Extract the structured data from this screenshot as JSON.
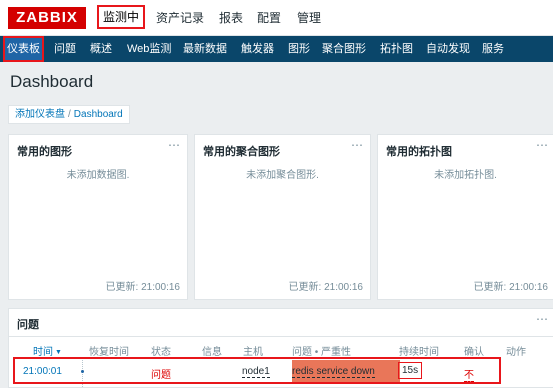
{
  "header": {
    "logo": "ZABBIX",
    "menu": [
      "监测中",
      "资产记录",
      "报表",
      "配置",
      "管理"
    ]
  },
  "subnav": [
    "仪表板",
    "问题",
    "概述",
    "Web监测",
    "最新数据",
    "触发器",
    "图形",
    "聚合图形",
    "拓扑图",
    "自动发现",
    "服务"
  ],
  "page": {
    "title": "Dashboard",
    "breadcrumb": [
      "添加仪表盘",
      "Dashboard"
    ]
  },
  "widgets": [
    {
      "title": "常用的图形",
      "empty": "未添加数据图.",
      "updated": "已更新: 21:00:16"
    },
    {
      "title": "常用的聚合图形",
      "empty": "未添加聚合图形.",
      "updated": "已更新: 21:00:16"
    },
    {
      "title": "常用的拓扑图",
      "empty": "未添加拓扑图.",
      "updated": "已更新: 21:00:16"
    }
  ],
  "problems": {
    "title": "问题",
    "columns": [
      "时间",
      "恢复时间",
      "状态",
      "信息",
      "主机",
      "问题 • 严重性",
      "持续时间",
      "确认",
      "动作"
    ],
    "rows": [
      {
        "time": "21:00:01",
        "recovery": "",
        "status": "问题",
        "info": "",
        "host": "node1",
        "problem": "redis service down",
        "duration": "15s",
        "ack": "不",
        "actions": ""
      }
    ]
  },
  "colors": {
    "brand": "#d40000",
    "nav": "#0a466a",
    "nav_active": "#1f65a6",
    "severity": "#e97659",
    "highlight": "#e8161b"
  },
  "icons": {
    "widget_menu": "⋯",
    "sort": "▼"
  }
}
